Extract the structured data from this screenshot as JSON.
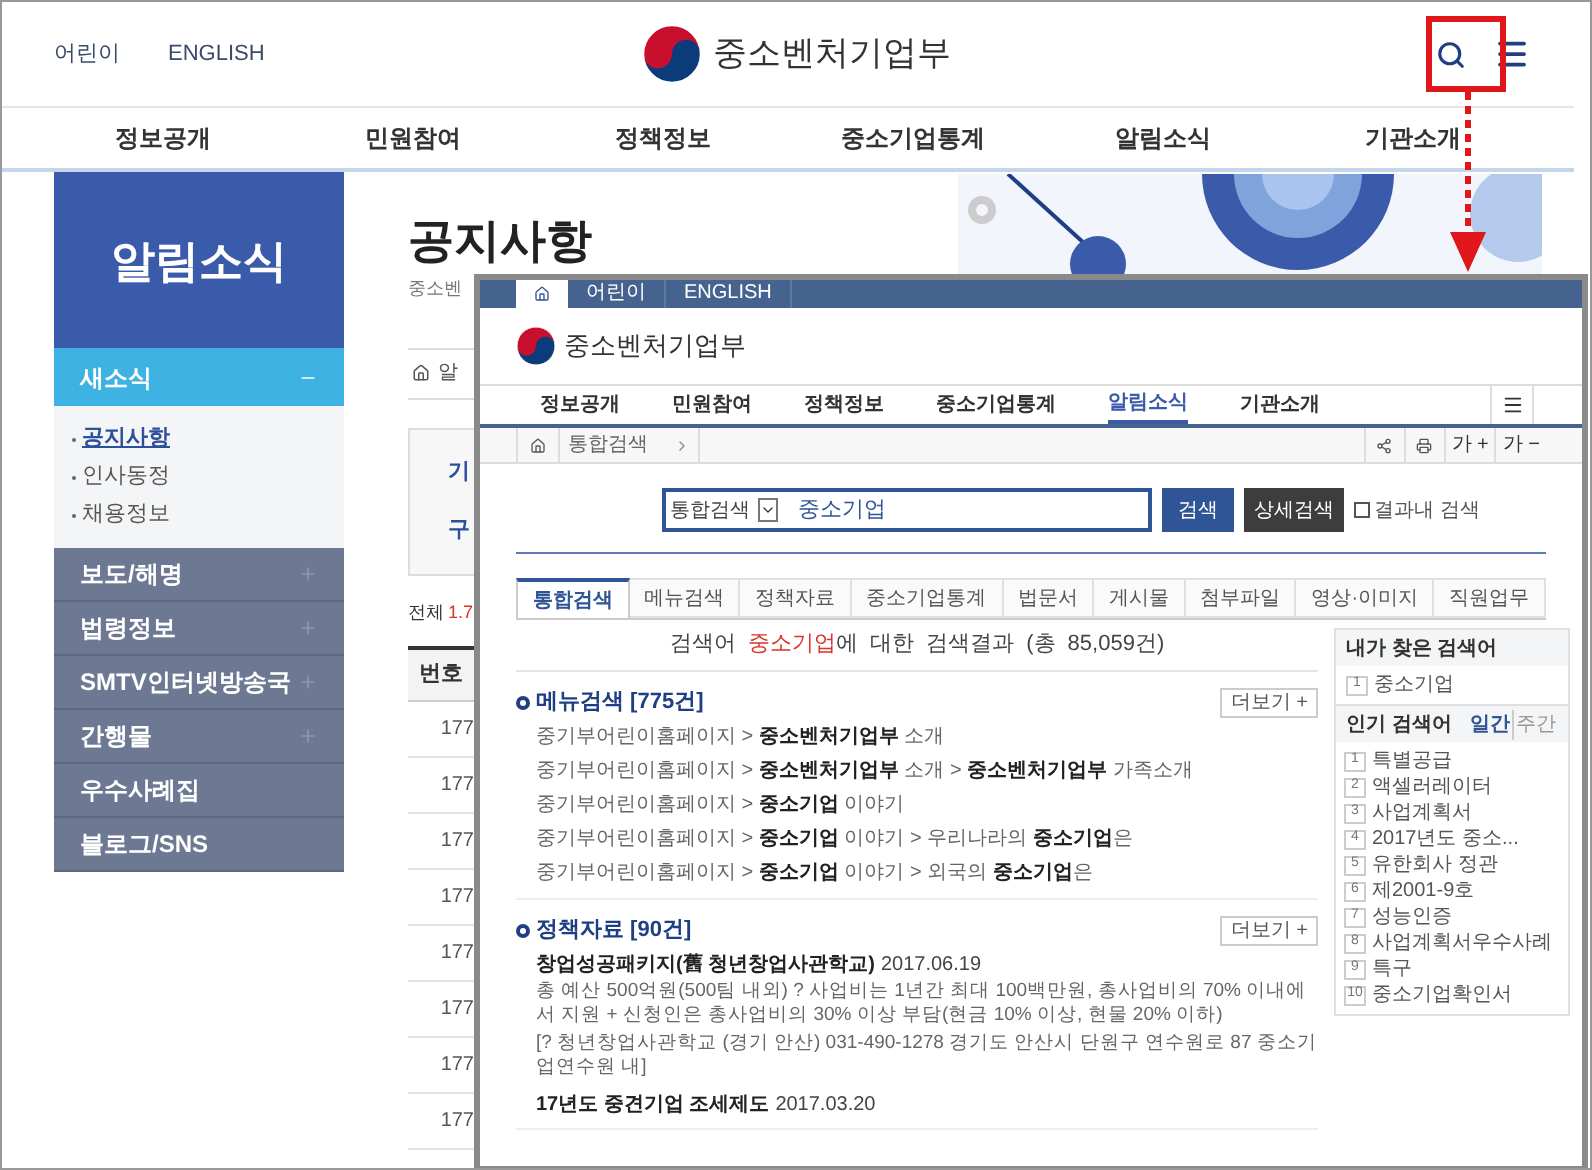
{
  "header": {
    "links": [
      "어린이",
      "ENGLISH"
    ],
    "logo": "중소벤처기업부"
  },
  "nav": [
    "정보공개",
    "민원참여",
    "정책정보",
    "중소기업통계",
    "알림소식",
    "기관소개"
  ],
  "sidebar": {
    "title": "알림소식",
    "groups": [
      {
        "label": "새소식",
        "kind": "folder",
        "expanded": true,
        "children": [
          {
            "label": "공지사항",
            "selected": true
          },
          {
            "label": "인사동정",
            "selected": false
          },
          {
            "label": "채용정보",
            "selected": false
          }
        ]
      },
      {
        "label": "보도/해명",
        "kind": "folder",
        "expanded": false
      },
      {
        "label": "법령정보",
        "kind": "folder",
        "expanded": false
      },
      {
        "label": "SMTV인터넷방송국",
        "kind": "folder",
        "expanded": false
      },
      {
        "label": "간행물",
        "kind": "folder",
        "expanded": false
      },
      {
        "label": "우수사례집",
        "kind": "link"
      },
      {
        "label": "블로그/SNS",
        "kind": "link"
      }
    ]
  },
  "page": {
    "title": "공지사항",
    "subtitle": "중소벤",
    "breadcrumb": "알",
    "notice_lines": [
      "기",
      "구"
    ],
    "total_label": "전체",
    "total_count": "1.7",
    "table": {
      "columns": [
        "번호"
      ],
      "rows": [
        "177",
        "177",
        "177",
        "177",
        "177",
        "177",
        "177",
        "177"
      ]
    }
  },
  "search_window": {
    "top_links": [
      "어린이",
      "ENGLISH"
    ],
    "logo": "중소벤처기업부",
    "nav": [
      {
        "label": "정보공개",
        "selected": false
      },
      {
        "label": "민원참여",
        "selected": false
      },
      {
        "label": "정책정보",
        "selected": false
      },
      {
        "label": "중소기업통계",
        "selected": false
      },
      {
        "label": "알림소식",
        "selected": true
      },
      {
        "label": "기관소개",
        "selected": false
      }
    ],
    "breadcrumb": "통합검색",
    "font_buttons": [
      "가 +",
      "가 −"
    ],
    "search": {
      "scope": "통합검색",
      "value": "중소기업",
      "buttons": [
        "검색",
        "상세검색"
      ],
      "in_results": {
        "label": "결과내 검색",
        "checked": false
      }
    },
    "tabs": [
      {
        "label": "통합검색",
        "selected": true
      },
      {
        "label": "메뉴검색",
        "selected": false
      },
      {
        "label": "정책자료",
        "selected": false
      },
      {
        "label": "중소기업통계",
        "selected": false
      },
      {
        "label": "법문서",
        "selected": false
      },
      {
        "label": "게시물",
        "selected": false
      },
      {
        "label": "첨부파일",
        "selected": false
      },
      {
        "label": "영상·이미지",
        "selected": false
      },
      {
        "label": "직원업무",
        "selected": false
      }
    ],
    "summary": "검색어 **중소기업**에 대한 검색결과 (총 85,059건)",
    "sections": [
      {
        "kind": "menu",
        "title": "메뉴검색 [775건]",
        "more": "더보기 +",
        "items": [
          "중기부어린이홈페이지 > **중소벤처기업부** 소개",
          "중기부어린이홈페이지 > **중소벤처기업부** 소개 > **중소벤처기업부** 가족소개",
          "중기부어린이홈페이지 > **중소기업** 이야기",
          "중기부어린이홈페이지 > **중소기업** 이야기 > 우리나라의 **중소기업**은",
          "중기부어린이홈페이지 > **중소기업** 이야기 > 외국의 **중소기업**은"
        ]
      },
      {
        "kind": "docs",
        "title": "정책자료 [90건]",
        "more": "더보기 +",
        "items": [
          {
            "title": "창업성공패키지(舊 청년창업사관학교)",
            "date": "2017.06.19",
            "description": "총 예산 500억원(500팀 내외) ? 사업비는 1년간 최대 100백만원, 총사업비의 70% 이내에서 지원 + 신청인은 총사업비의 30% 이상 부담(현금 10% 이상, 현물 20% 이하)",
            "address": "[? 청년창업사관학교 (경기 안산) 031-490-1278 경기도 안산시 단원구 연수원로 87 중소기업연수원 내]"
          },
          {
            "title": "17년도 중견기업 조세제도",
            "date": "2017.03.20"
          }
        ]
      }
    ],
    "recent": {
      "title": "내가 찾은 검색어",
      "items": [
        {
          "rank": "1",
          "label": "중소기업"
        }
      ]
    },
    "popular": {
      "title": "인기 검색어",
      "periods": [
        {
          "label": "일간",
          "selected": true
        },
        {
          "label": "주간",
          "selected": false
        }
      ],
      "items": [
        {
          "rank": "1",
          "label": "특별공급"
        },
        {
          "rank": "2",
          "label": "액셀러레이터"
        },
        {
          "rank": "3",
          "label": "사업계획서"
        },
        {
          "rank": "4",
          "label": "2017년도 중소..."
        },
        {
          "rank": "5",
          "label": "유한회사 정관"
        },
        {
          "rank": "6",
          "label": "제2001-9호"
        },
        {
          "rank": "7",
          "label": "성능인증"
        },
        {
          "rank": "8",
          "label": "사업계획서우수사례"
        },
        {
          "rank": "9",
          "label": "특구"
        },
        {
          "rank": "10",
          "label": "중소기업확인서"
        }
      ]
    }
  }
}
